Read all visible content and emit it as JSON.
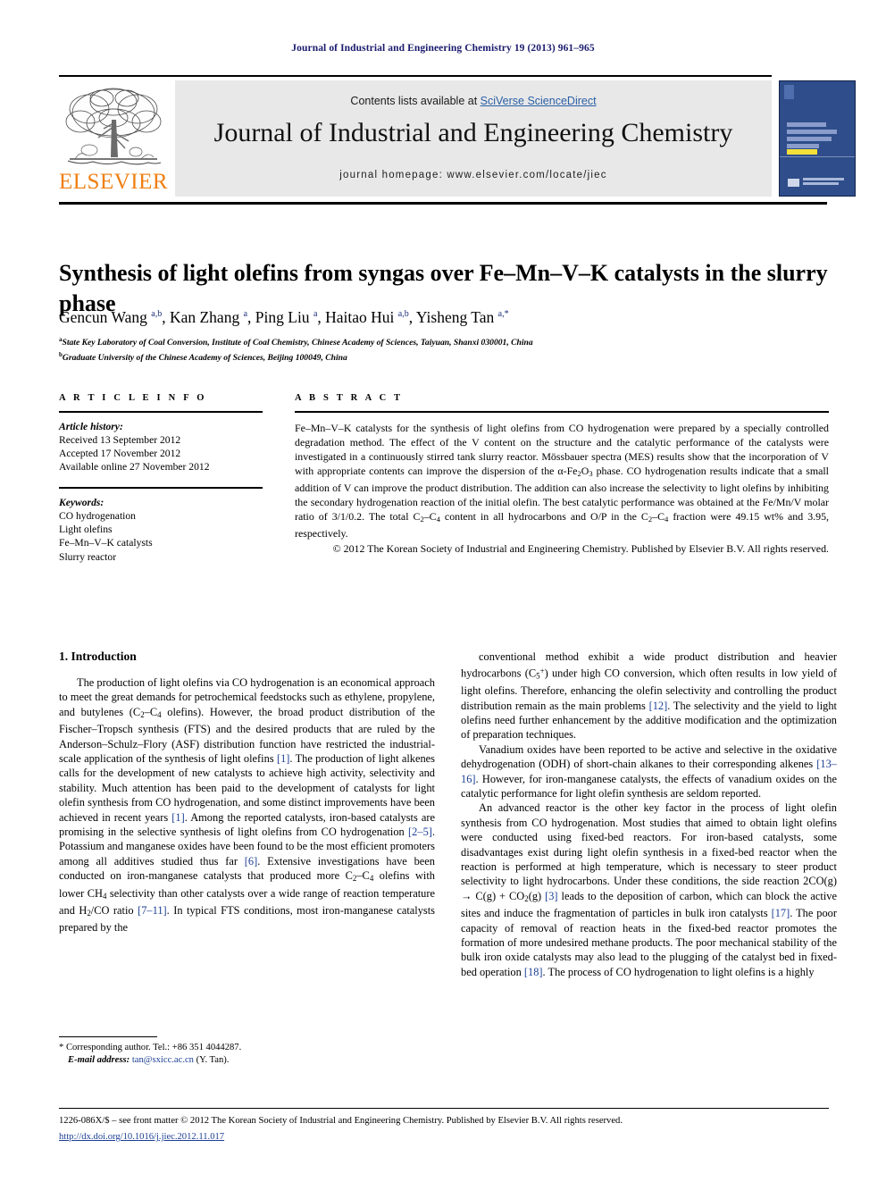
{
  "running_head": "Journal of Industrial and Engineering Chemistry 19 (2013) 961–965",
  "masthead": {
    "contents_prefix": "Contents lists available at ",
    "sciencedirect_link": "SciVerse ScienceDirect",
    "journal_name": "Journal of Industrial and Engineering Chemistry",
    "homepage": "journal homepage: www.elsevier.com/locate/jiec",
    "publisher_wordmark": "ELSEVIER",
    "publisher_color": "#F07F12",
    "link_color": "#2a5fa5",
    "cover_bg_color": "#2e4d8a"
  },
  "article": {
    "title": "Synthesis of light olefins from syngas over Fe–Mn–V–K catalysts in the slurry phase",
    "authors_html": "Gencun Wang <sup>a,b</sup>, Kan Zhang <sup>a</sup>, Ping Liu <sup>a</sup>, Haitao Hui <sup>a,b</sup>, Yisheng Tan <sup>a,*</sup>",
    "affiliations": [
      "State Key Laboratory of Coal Conversion, Institute of Coal Chemistry, Chinese Academy of Sciences, Taiyuan, Shanxi 030001, China",
      "Graduate University of the Chinese Academy of Sciences, Beijing 100049, China"
    ]
  },
  "article_info": {
    "label": "A R T I C L E  I N F O",
    "history_header": "Article history:",
    "history": [
      "Received 13 September 2012",
      "Accepted 17 November 2012",
      "Available online 27 November 2012"
    ],
    "keywords_header": "Keywords:",
    "keywords": [
      "CO hydrogenation",
      "Light olefins",
      "Fe–Mn–V–K catalysts",
      "Slurry reactor"
    ]
  },
  "abstract": {
    "label": "A B S T R A C T",
    "body_html": "Fe–Mn–V–K catalysts for the synthesis of light olefins from CO hydrogenation were prepared by a specially controlled degradation method. The effect of the V content on the structure and the catalytic performance of the catalysts were investigated in a continuously stirred tank slurry reactor. Mössbauer spectra (MES) results show that the incorporation of V with appropriate contents can improve the dispersion of the α-Fe<sub>2</sub>O<sub>3</sub> phase. CO hydrogenation results indicate that a small addition of V can improve the product distribution. The addition can also increase the selectivity to light olefins by inhibiting the secondary hydrogenation reaction of the initial olefin. The best catalytic performance was obtained at the Fe/Mn/V molar ratio of 3/1/0.2. The total C<sub>2</sub>–C<sub>4</sub> content in all hydrocarbons and O/P in the C<sub>2</sub>–C<sub>4</sub> fraction were 49.15 wt% and 3.95, respectively.",
    "copyright": "© 2012 The Korean Society of Industrial and Engineering Chemistry. Published by Elsevier B.V. All rights reserved."
  },
  "body": {
    "section_heading": "1. Introduction",
    "left_paragraphs_html": [
      "The production of light olefins via CO hydrogenation is an economical approach to meet the great demands for petrochemical feedstocks such as ethylene, propylene, and butylenes (C<sub>2</sub>–C<sub>4</sub> olefins). However, the broad product distribution of the Fischer–Tropsch synthesis (FTS) and the desired products that are ruled by the Anderson–Schulz–Flory (ASF) distribution function have restricted the industrial-scale application of the synthesis of light olefins <span class=\"ref\">[1]</span>. The production of light alkenes calls for the development of new catalysts to achieve high activity, selectivity and stability. Much attention has been paid to the development of catalysts for light olefin synthesis from CO hydrogenation, and some distinct improvements have been achieved in recent years <span class=\"ref\">[1]</span>. Among the reported catalysts, iron-based catalysts are promising in the selective synthesis of light olefins from CO hydrogenation <span class=\"ref\">[2–5]</span>. Potassium and manganese oxides have been found to be the most efficient promoters among all additives studied thus far <span class=\"ref\">[6]</span>. Extensive investigations have been conducted on iron-manganese catalysts that produced more C<sub>2</sub>–C<sub>4</sub> olefins with lower CH<sub>4</sub> selectivity than other catalysts over a wide range of reaction temperature and H<sub>2</sub>/CO ratio <span class=\"ref\">[7–11]</span>. In typical FTS conditions, most iron-manganese catalysts prepared by the"
    ],
    "right_paragraphs_html": [
      "conventional method exhibit a wide product distribution and heavier hydrocarbons (C<sub>5</sub><sup class=\"inl\">+</sup>) under high CO conversion, which often results in low yield of light olefins. Therefore, enhancing the olefin selectivity and controlling the product distribution remain as the main problems <span class=\"ref\">[12]</span>. The selectivity and the yield to light olefins need further enhancement by the additive modification and the optimization of preparation techniques.",
      "Vanadium oxides have been reported to be active and selective in the oxidative dehydrogenation (ODH) of short-chain alkanes to their corresponding alkenes <span class=\"ref\">[13–16]</span>. However, for iron-manganese catalysts, the effects of vanadium oxides on the catalytic performance for light olefin synthesis are seldom reported.",
      "An advanced reactor is the other key factor in the process of light olefin synthesis from CO hydrogenation. Most studies that aimed to obtain light olefins were conducted using fixed-bed reactors. For iron-based catalysts, some disadvantages exist during light olefin synthesis in a fixed-bed reactor when the reaction is performed at high temperature, which is necessary to steer product selectivity to light hydrocarbons. Under these conditions, the side reaction 2CO(g) → C(g) + CO<sub>2</sub>(g) <span class=\"ref\">[3]</span> leads to the deposition of carbon, which can block the active sites and induce the fragmentation of particles in bulk iron catalysts <span class=\"ref\">[17]</span>. The poor capacity of removal of reaction heats in the fixed-bed reactor promotes the formation of more undesired methane products. The poor mechanical stability of the bulk iron oxide catalysts may also lead to the plugging of the catalyst bed in fixed-bed operation <span class=\"ref\">[18]</span>. The process of CO hydrogenation to light olefins is a highly"
    ]
  },
  "footnote": {
    "corresponding_html": "* Corresponding author. Tel.: +86 351 4044287.",
    "email_html": "<span class=\"em\">E-mail address:</span> <span class=\"mail\">tan@sxicc.ac.cn</span> (Y. Tan)."
  },
  "page_footer": {
    "front_matter": "1226-086X/$ – see front matter © 2012 The Korean Society of Industrial and Engineering Chemistry. Published by Elsevier B.V. All rights reserved.",
    "doi": "http://dx.doi.org/10.1016/j.jiec.2012.11.017"
  }
}
